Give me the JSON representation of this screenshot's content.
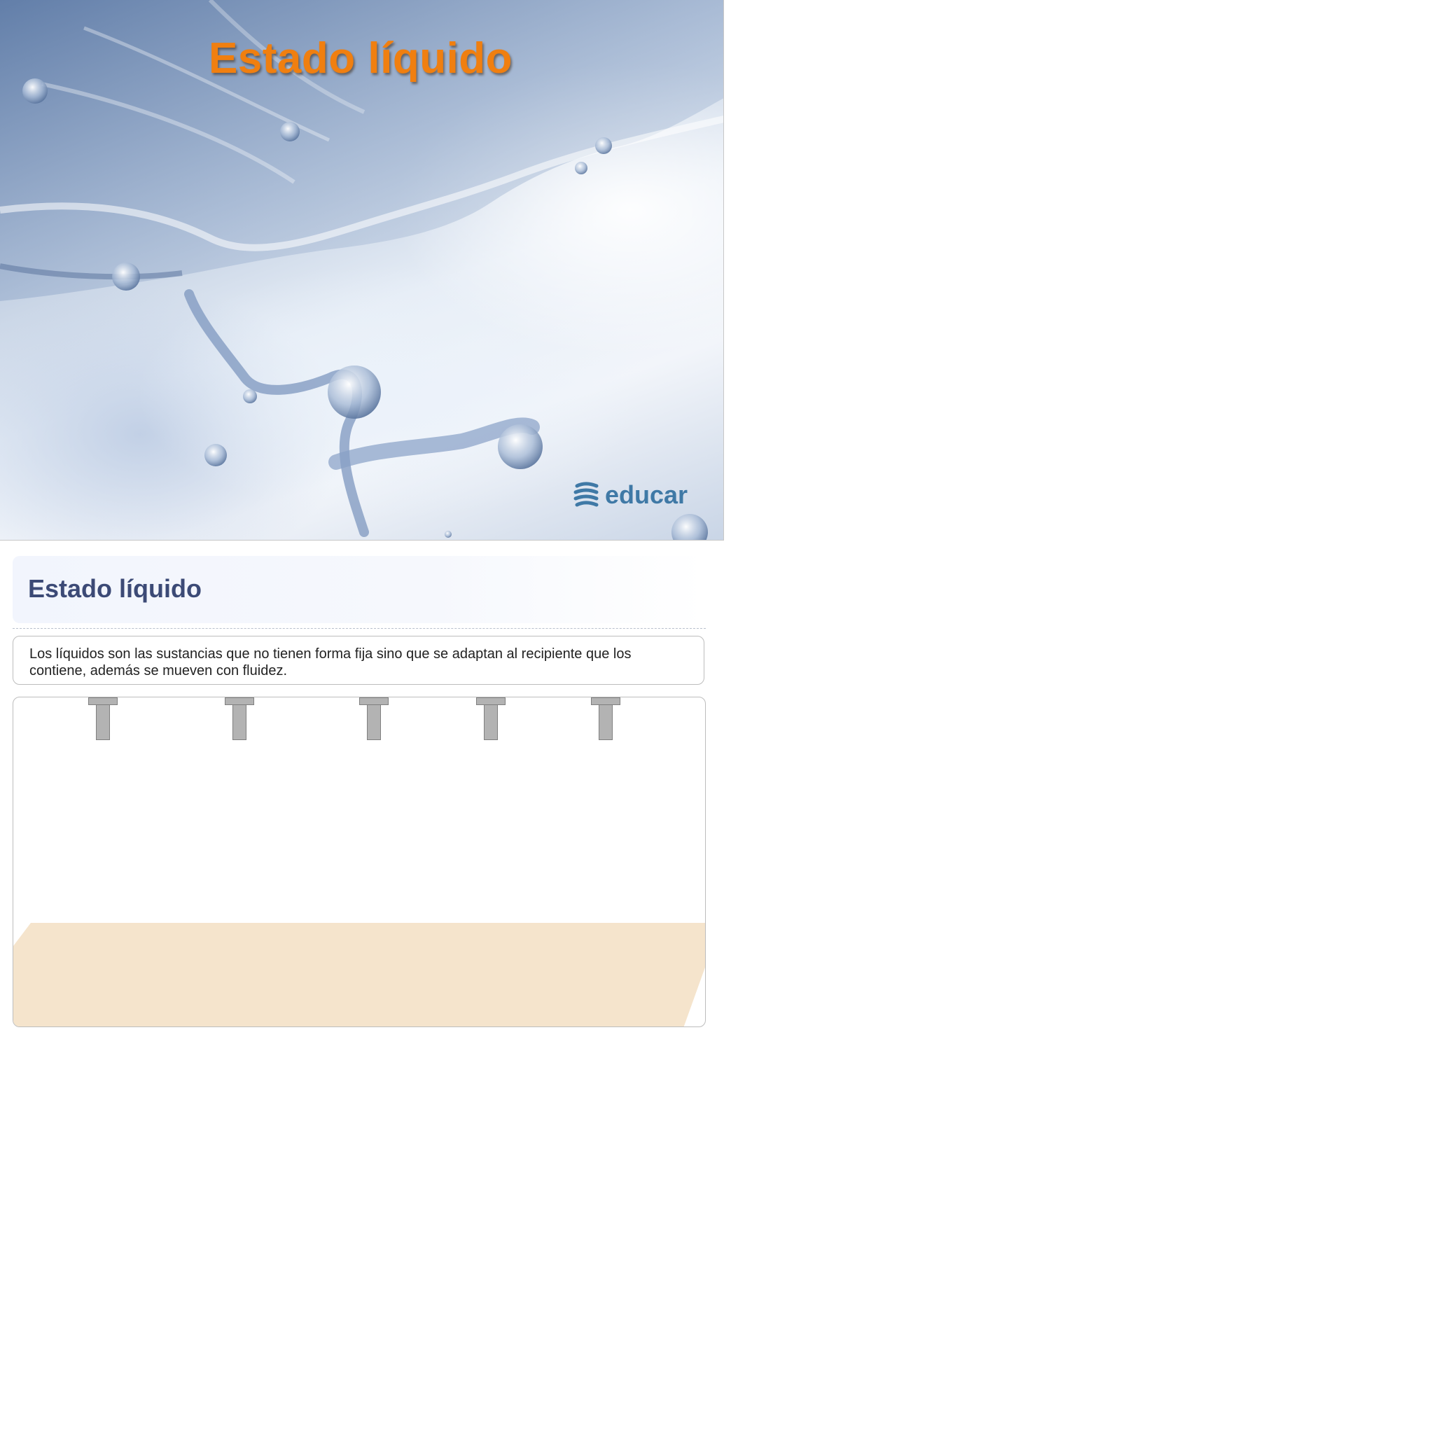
{
  "cover": {
    "title": "Estado líquido",
    "logo_text": "educar",
    "logo_icon": "educar-logo-icon",
    "title_color": "#f07f10"
  },
  "header": {
    "title": "Estado líquido"
  },
  "description": {
    "text": "Los líquidos son las sustancias que no tienen forma fija sino que se adaptan al recipiente que los contiene, además se mueven con fluidez."
  },
  "stage": {
    "taps": [
      {
        "name": "tap-1"
      },
      {
        "name": "tap-2"
      },
      {
        "name": "tap-3"
      },
      {
        "name": "tap-4"
      },
      {
        "name": "tap-5"
      }
    ],
    "floor_color": "#f5e4cc"
  },
  "colors": {
    "header_text": "#3c4a76",
    "header_bg": "#f2f5fd",
    "panel_border": "#bdbdbd"
  }
}
